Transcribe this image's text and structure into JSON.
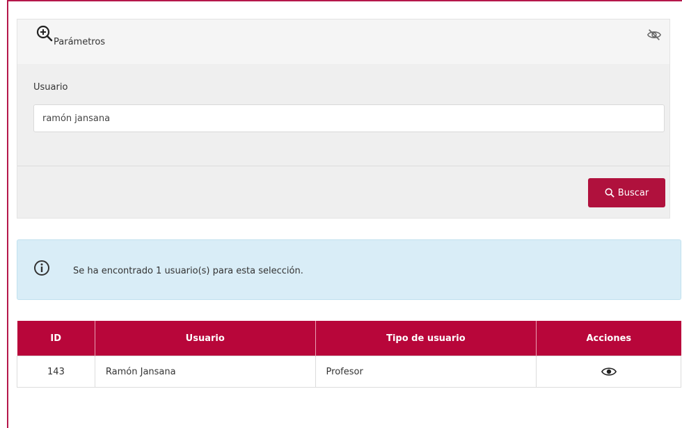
{
  "panel": {
    "title": "Parámetros",
    "field_label": "Usuario",
    "field_value": "ramón jansana",
    "search_button": "Buscar"
  },
  "alert": {
    "message": "Se ha encontrado 1 usuario(s) para esta selección."
  },
  "table": {
    "headers": [
      "ID",
      "Usuario",
      "Tipo de usuario",
      "Acciones"
    ],
    "rows": [
      {
        "id": "143",
        "usuario": "Ramón Jansana",
        "tipo": "Profesor"
      }
    ]
  },
  "colors": {
    "accent": "#b0113d",
    "header_bg": "#b8063a",
    "alert_bg": "#d9edf7"
  },
  "icons": [
    "zoom-in-icon",
    "eye-off-icon",
    "search-icon",
    "info-icon",
    "eye-icon"
  ]
}
